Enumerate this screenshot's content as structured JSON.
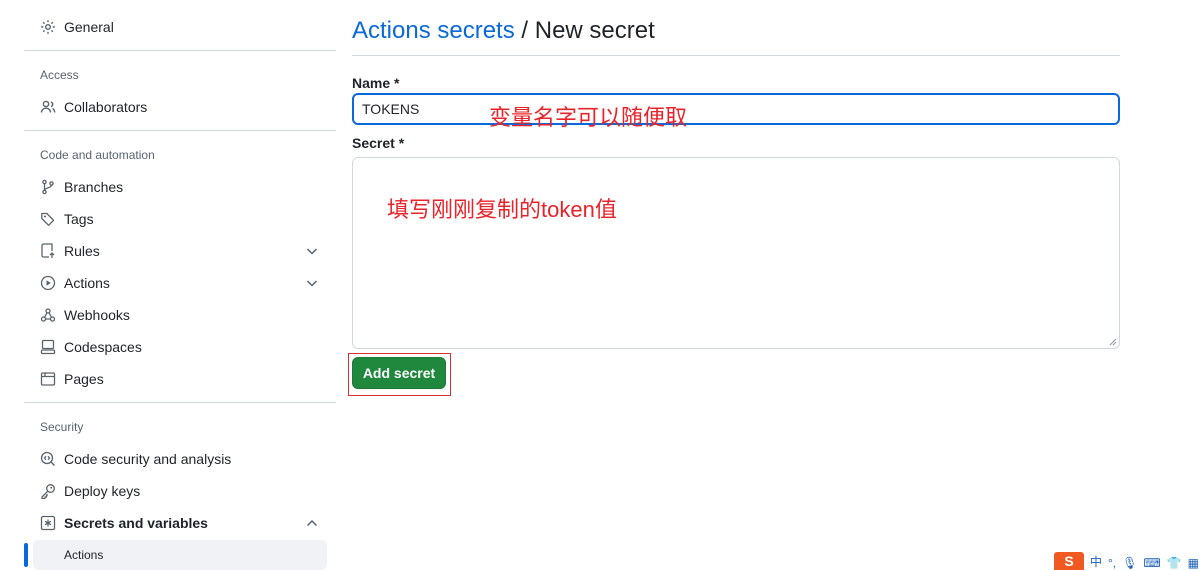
{
  "sidebar": {
    "general": "General",
    "access_label": "Access",
    "collaborators": "Collaborators",
    "code_automation_label": "Code and automation",
    "branches": "Branches",
    "tags": "Tags",
    "rules": "Rules",
    "actions": "Actions",
    "webhooks": "Webhooks",
    "codespaces": "Codespaces",
    "pages": "Pages",
    "security_label": "Security",
    "code_security": "Code security and analysis",
    "deploy_keys": "Deploy keys",
    "secrets_variables": "Secrets and variables",
    "secrets_actions": "Actions"
  },
  "header": {
    "breadcrumb_link": "Actions secrets",
    "separator": "/",
    "current": "New secret"
  },
  "form": {
    "name_label": "Name *",
    "name_value": "TOKENS",
    "secret_label": "Secret *",
    "secret_value": "",
    "submit_label": "Add secret"
  },
  "annotations": {
    "name_note": "变量名字可以随便取",
    "secret_note": "填写刚刚复制的token值"
  },
  "tray": {
    "logo": "S",
    "lang": "中"
  },
  "colors": {
    "link": "#0969da",
    "primary_button": "#1f883d",
    "annotation": "#e8232a",
    "focus_border": "#0969da"
  }
}
